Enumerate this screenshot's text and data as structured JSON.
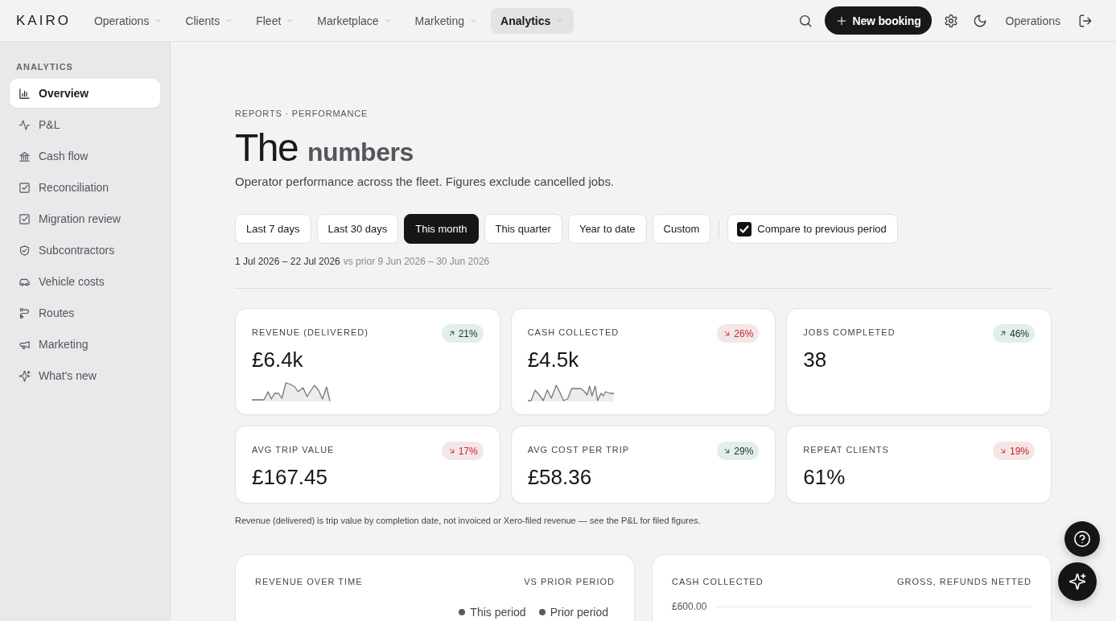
{
  "brand": {
    "logo": "KAIRO"
  },
  "nav": {
    "items": [
      {
        "label": "Operations",
        "selected": false
      },
      {
        "label": "Clients",
        "selected": false
      },
      {
        "label": "Fleet",
        "selected": false
      },
      {
        "label": "Marketplace",
        "selected": false
      },
      {
        "label": "Marketing",
        "selected": false
      },
      {
        "label": "Analytics",
        "selected": true
      }
    ]
  },
  "toolbar": {
    "new_booking": "New booking",
    "workspace": "Operations"
  },
  "sidebar": {
    "section": "ANALYTICS",
    "items": [
      {
        "label": "Overview",
        "selected": true
      },
      {
        "label": "P&L",
        "selected": false
      },
      {
        "label": "Cash flow",
        "selected": false
      },
      {
        "label": "Reconciliation",
        "selected": false
      },
      {
        "label": "Migration review",
        "selected": false
      },
      {
        "label": "Subcontractors",
        "selected": false
      },
      {
        "label": "Vehicle costs",
        "selected": false
      },
      {
        "label": "Routes",
        "selected": false
      },
      {
        "label": "Marketing",
        "selected": false
      },
      {
        "label": "What's new",
        "selected": false
      }
    ]
  },
  "header": {
    "eyebrow": "REPORTS · PERFORMANCE",
    "title": "The **numbers**",
    "subtitle": "Operator performance across the fleet. Figures exclude cancelled jobs."
  },
  "filters": {
    "presets": [
      {
        "label": "Last 7 days",
        "selected": false
      },
      {
        "label": "Last 30 days",
        "selected": false
      },
      {
        "label": "This month",
        "selected": true
      },
      {
        "label": "This quarter",
        "selected": false
      },
      {
        "label": "Year to date",
        "selected": false
      },
      {
        "label": "Custom",
        "selected": false
      }
    ],
    "compare": {
      "label": "Compare to previous period",
      "checked": true
    },
    "range": "1 Jul 2026 – 22 Jul 2026",
    "prior_range": "vs prior 9 Jun 2026 – 30 Jun 2026"
  },
  "kpis": [
    {
      "label": "REVENUE (DELIVERED)",
      "value": "£6.4k",
      "delta": {
        "text": "21%",
        "rising": true,
        "favorable": true
      },
      "sparkline": true
    },
    {
      "label": "CASH COLLECTED",
      "value": "£4.5k",
      "delta": {
        "text": "26%",
        "rising": false,
        "favorable": false
      },
      "sparkline": true
    },
    {
      "label": "JOBS COMPLETED",
      "value": "38",
      "delta": {
        "text": "46%",
        "rising": true,
        "favorable": true
      },
      "sparkline": false
    },
    {
      "label": "AVG TRIP VALUE",
      "value": "£167.45",
      "delta": {
        "text": "17%",
        "rising": false,
        "favorable": false
      },
      "sparkline": false
    },
    {
      "label": "AVG COST PER TRIP",
      "value": "£58.36",
      "delta": {
        "text": "29%",
        "rising": false,
        "favorable": true
      },
      "sparkline": false
    },
    {
      "label": "REPEAT CLIENTS",
      "value": "61%",
      "delta": {
        "text": "19%",
        "rising": false,
        "favorable": false
      },
      "sparkline": false
    }
  ],
  "footnote": "Revenue (delivered) is trip value by completion date, not invoiced or Xero-filed revenue — see the P&L for filed figures.",
  "charts": [
    {
      "title": "REVENUE OVER TIME",
      "caption": "VS PRIOR PERIOD",
      "legend": [
        {
          "label": "This period"
        },
        {
          "label": "Prior period"
        }
      ]
    },
    {
      "title": "CASH COLLECTED",
      "caption": "GROSS, REFUNDS NETTED",
      "y_tick": "£600.00"
    }
  ]
}
